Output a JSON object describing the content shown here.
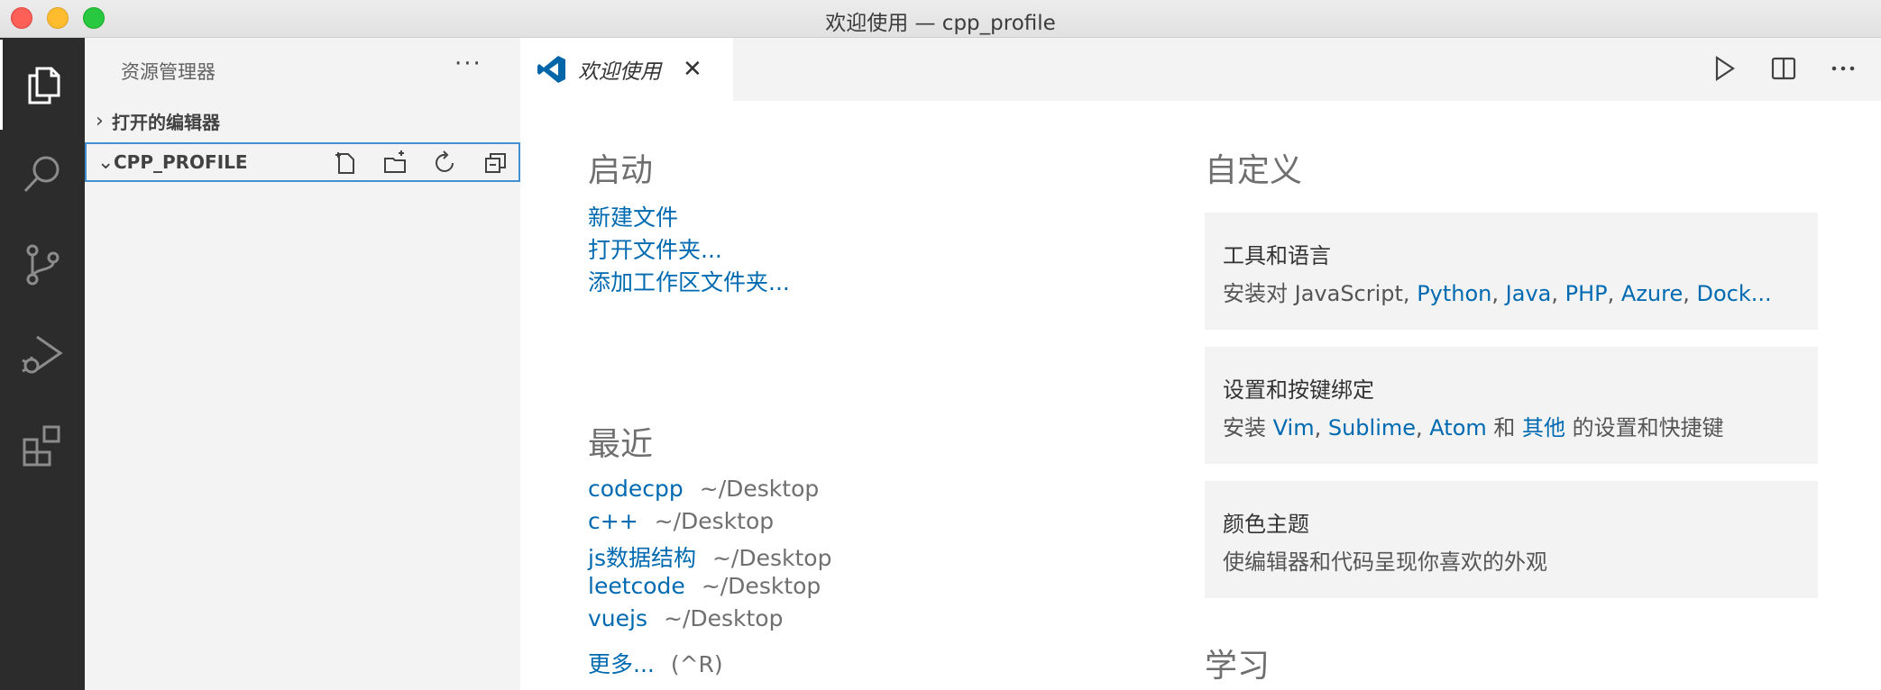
{
  "window": {
    "title": "欢迎使用 — cpp_profile"
  },
  "activity_bar": {
    "items": [
      {
        "name": "explorer",
        "active": true
      },
      {
        "name": "search",
        "active": false
      },
      {
        "name": "source-control",
        "active": false
      },
      {
        "name": "run-debug",
        "active": false
      },
      {
        "name": "extensions",
        "active": false
      }
    ]
  },
  "sidebar": {
    "title": "资源管理器",
    "more": "···",
    "open_editors": {
      "label": "打开的编辑器",
      "chevron": "›"
    },
    "project": {
      "label": "CPP_PROFILE",
      "chevron": "⌄"
    }
  },
  "tab": {
    "label": "欢迎使用",
    "close": "✕"
  },
  "welcome": {
    "start": {
      "heading": "启动",
      "links": [
        "新建文件",
        "打开文件夹...",
        "添加工作区文件夹..."
      ]
    },
    "recent": {
      "heading": "最近",
      "items": [
        {
          "name": "codecpp",
          "path": "~/Desktop"
        },
        {
          "name": "c++",
          "path": "~/Desktop"
        },
        {
          "name": "js数据结构",
          "path": "~/Desktop"
        },
        {
          "name": "leetcode",
          "path": "~/Desktop"
        },
        {
          "name": "vuejs",
          "path": "~/Desktop"
        }
      ],
      "more_label": "更多...",
      "more_shortcut": "(^R)"
    },
    "customize": {
      "heading": "自定义",
      "tools": {
        "title": "工具和语言",
        "prefix": "安装对 JavaScript, ",
        "links": [
          "Python",
          "Java",
          "PHP",
          "Azure",
          "Dock..."
        ]
      },
      "keymaps": {
        "title": "设置和按键绑定",
        "prefix": "安装 ",
        "vim": "Vim",
        "sublime": "Sublime",
        "atom": "Atom",
        "and": " 和 ",
        "others": "其他",
        "suffix": " 的设置和快捷键"
      },
      "theme": {
        "title": "颜色主题",
        "desc": "使编辑器和代码呈现你喜欢的外观"
      }
    },
    "learn": {
      "heading": "学习"
    }
  },
  "colors": {
    "link": "#006ab1",
    "activity_bg": "#2c2c2c",
    "focus_border": "#3f8fd2",
    "vscode_blue": "#0065a9"
  }
}
